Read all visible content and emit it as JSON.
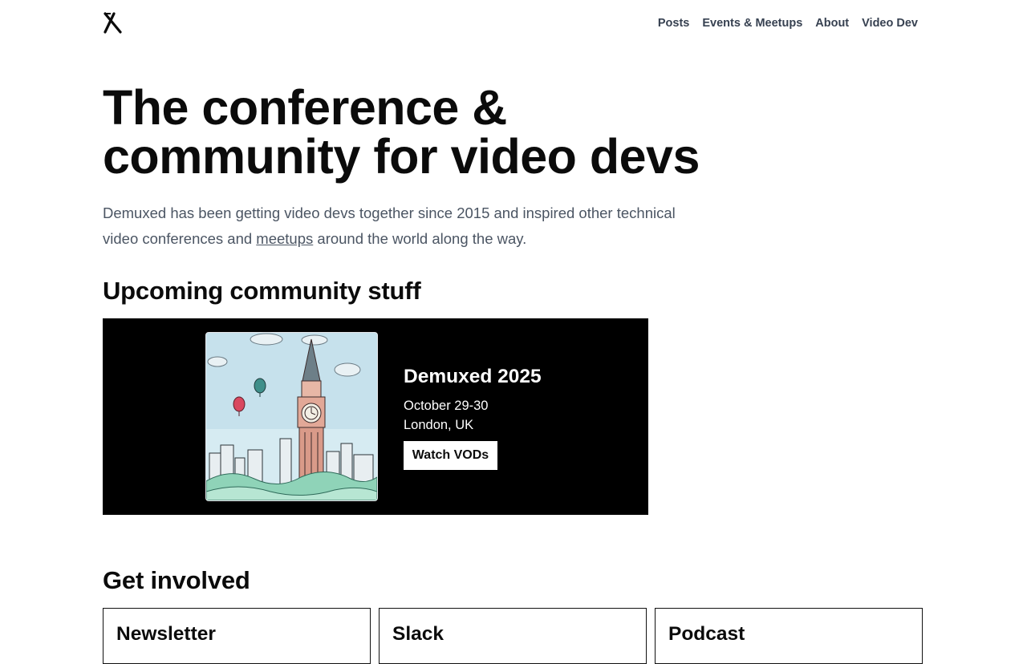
{
  "header": {
    "logo_icon": "x-logo-icon",
    "nav": [
      {
        "label": "Posts"
      },
      {
        "label": "Events & Meetups"
      },
      {
        "label": "About"
      },
      {
        "label": "Video Dev"
      }
    ]
  },
  "hero": {
    "title_line1": "The conference &",
    "title_line2": "community for video devs",
    "intro_before": "Demuxed has been getting video devs together since 2015 and inspired other technical video conferences and ",
    "intro_link": "meetups",
    "intro_after": " around the world along the way."
  },
  "upcoming": {
    "heading": "Upcoming community stuff",
    "event": {
      "title": "Demuxed 2025",
      "date": "October 29-30",
      "location": "London, UK",
      "button_label": "Watch VODs",
      "art_icon": "big-ben-illustration"
    }
  },
  "get_involved": {
    "heading": "Get involved",
    "cards": [
      {
        "title": "Newsletter"
      },
      {
        "title": "Slack"
      },
      {
        "title": "Podcast"
      }
    ]
  },
  "colors": {
    "text": "#0b0b0b",
    "nav_text": "#374151",
    "muted_text": "#4b5563",
    "event_card_bg": "#000000"
  }
}
